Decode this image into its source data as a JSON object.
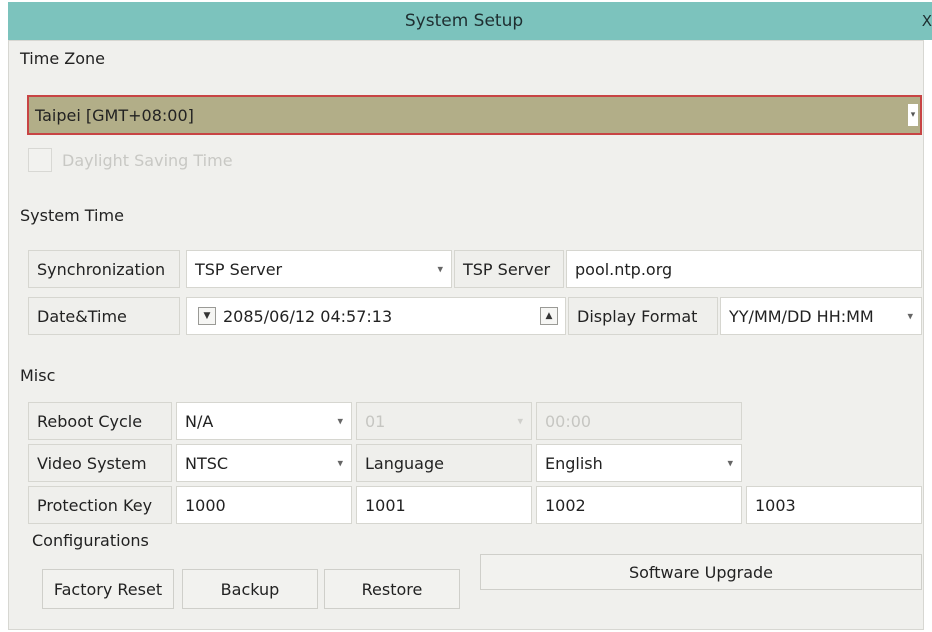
{
  "window": {
    "title": "System Setup",
    "close_label": "X"
  },
  "time_zone": {
    "section_label": "Time Zone",
    "selected": "Taipei [GMT+08:00]",
    "daylight_saving_label": "Daylight Saving Time",
    "daylight_saving_checked": false
  },
  "system_time": {
    "section_label": "System Time",
    "synchronization_label": "Synchronization",
    "synchronization_value": "TSP Server",
    "tsp_server_label": "TSP Server",
    "tsp_server_value": "pool.ntp.org",
    "datetime_label": "Date&Time",
    "datetime_value": "2085/06/12 04:57:13",
    "display_format_label": "Display Format",
    "display_format_value": "YY/MM/DD HH:MM"
  },
  "misc": {
    "section_label": "Misc",
    "reboot_cycle_label": "Reboot Cycle",
    "reboot_cycle_value": "N/A",
    "reboot_day_value": "01",
    "reboot_time_value": "00:00",
    "video_system_label": "Video System",
    "video_system_value": "NTSC",
    "language_label": "Language",
    "language_value": "English",
    "protection_key_label": "Protection Key",
    "protection_keys": [
      "1000",
      "1001",
      "1002",
      "1003"
    ],
    "configurations_label": "Configurations",
    "factory_reset_label": "Factory Reset",
    "backup_label": "Backup",
    "restore_label": "Restore",
    "software_upgrade_label": "Software Upgrade"
  },
  "colors": {
    "titlebar": "#7cc3bd",
    "timezone_highlight": "#b2ae88",
    "timezone_border": "#c84444"
  }
}
